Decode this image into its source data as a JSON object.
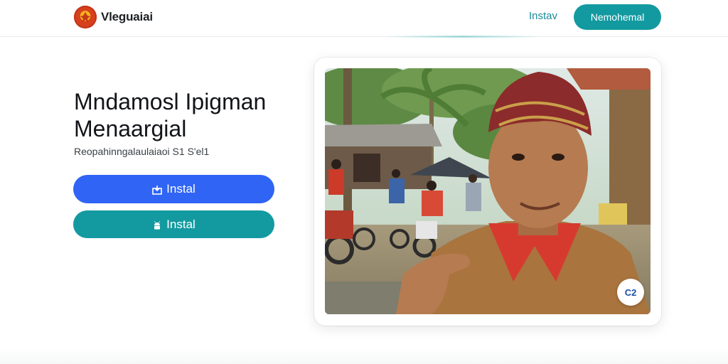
{
  "header": {
    "brand_name": "Vleguaiai",
    "logo_icon": "emblem-icon",
    "nav_link": "Instav",
    "cta_label": "Nemohemal"
  },
  "hero": {
    "title_line1": "Mndamosl Ipigman",
    "title_line2": "Menaargial",
    "subtitle": "Reopahinngalaulaiaoi S1 S'el1",
    "primary_button": {
      "label": "Instal",
      "icon": "download-icon"
    },
    "secondary_button": {
      "label": "Instal",
      "icon": "android-icon"
    }
  },
  "photo_card": {
    "image_alt": "Man in patterned head cloth and red collared shirt smiling in a village street with motorbikes and palm trees",
    "badge_label": "C2"
  },
  "colors": {
    "primary_blue": "#2f64f5",
    "teal": "#139aa0",
    "link": "#1b8c9a"
  }
}
